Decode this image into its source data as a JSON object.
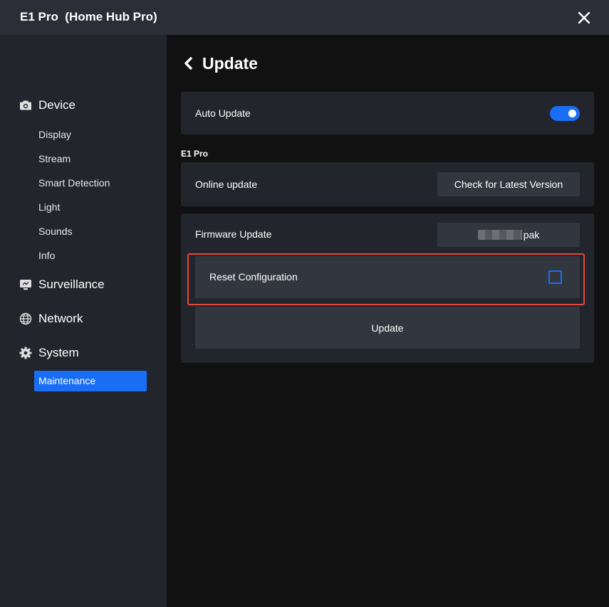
{
  "window": {
    "title": "E1 Pro  (Home Hub Pro)"
  },
  "sidebar": {
    "sections": [
      {
        "label": "Device",
        "icon": "camera-icon"
      },
      {
        "label": "Surveillance",
        "icon": "monitor-icon"
      },
      {
        "label": "Network",
        "icon": "globe-icon"
      },
      {
        "label": "System",
        "icon": "gear-icon"
      }
    ],
    "device_items": [
      "Display",
      "Stream",
      "Smart Detection",
      "Light",
      "Sounds",
      "Info"
    ],
    "system_items": [
      "Maintenance"
    ],
    "active_item": "Maintenance"
  },
  "main": {
    "title": "Update",
    "auto_update": {
      "label": "Auto Update",
      "enabled": true
    },
    "group_label": "E1 Pro",
    "online_update": {
      "label": "Online update",
      "button": "Check for Latest Version"
    },
    "firmware": {
      "label": "Firmware Update",
      "file_suffix": "pak"
    },
    "reset": {
      "label": "Reset Configuration",
      "checked": false
    },
    "update_button": "Update"
  },
  "colors": {
    "accent": "#1a6ef5",
    "highlight": "#e5483b",
    "background": "#111111",
    "panel": "#22252c"
  }
}
